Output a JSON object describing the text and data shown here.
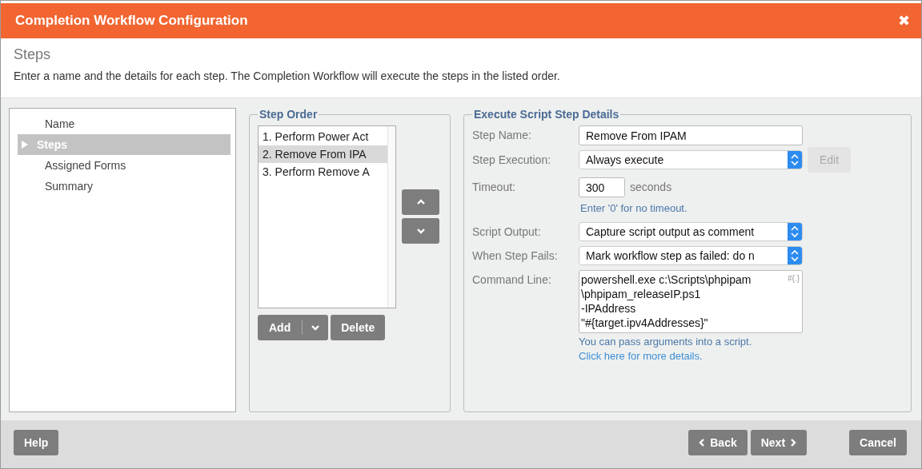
{
  "window": {
    "title": "Completion Workflow Configuration",
    "close": "✖"
  },
  "header": {
    "title": "Steps",
    "description": "Enter a name and the details for each step. The Completion Workflow will execute the steps in the listed order."
  },
  "nav": [
    {
      "label": "Name",
      "selected": false
    },
    {
      "label": "Steps",
      "selected": true
    },
    {
      "label": "Assigned Forms",
      "selected": false
    },
    {
      "label": "Summary",
      "selected": false
    }
  ],
  "step_order": {
    "title": "Step Order",
    "items": [
      {
        "label": "1. Perform Power Act",
        "selected": false
      },
      {
        "label": "2. Remove From IPA",
        "selected": true
      },
      {
        "label": "3. Perform Remove A",
        "selected": false
      }
    ],
    "add": "Add",
    "delete": "Delete"
  },
  "details": {
    "title": "Execute Script Step Details",
    "fields": [
      {
        "kind": "text",
        "label": "Step Name:",
        "value": "Remove From IPAM"
      },
      {
        "kind": "select",
        "label": "Step Execution:",
        "value": "Always execute",
        "button": "Edit",
        "button_disabled": true
      },
      {
        "kind": "timeout",
        "label": "Timeout:",
        "value": "300",
        "unit": "seconds",
        "hint": "Enter '0' for no timeout."
      },
      {
        "kind": "select",
        "label": "Script Output:",
        "value": "Capture script output as comment"
      },
      {
        "kind": "select",
        "label": "When Step Fails:",
        "value": "Mark workflow step as failed: do n"
      },
      {
        "kind": "textarea",
        "label": "Command Line:",
        "lines": [
          "powershell.exe c:\\Scripts\\phpipam",
          "\\phpipam_releaseIP.ps1",
          "-IPAddress",
          "\"#{target.ipv4Addresses}\""
        ],
        "insert": "#{.}",
        "hint": "You can pass arguments into a script.",
        "link": "Click here for more details."
      }
    ]
  },
  "footer": {
    "help": "Help",
    "back": "Back",
    "next": "Next",
    "cancel": "Cancel"
  }
}
